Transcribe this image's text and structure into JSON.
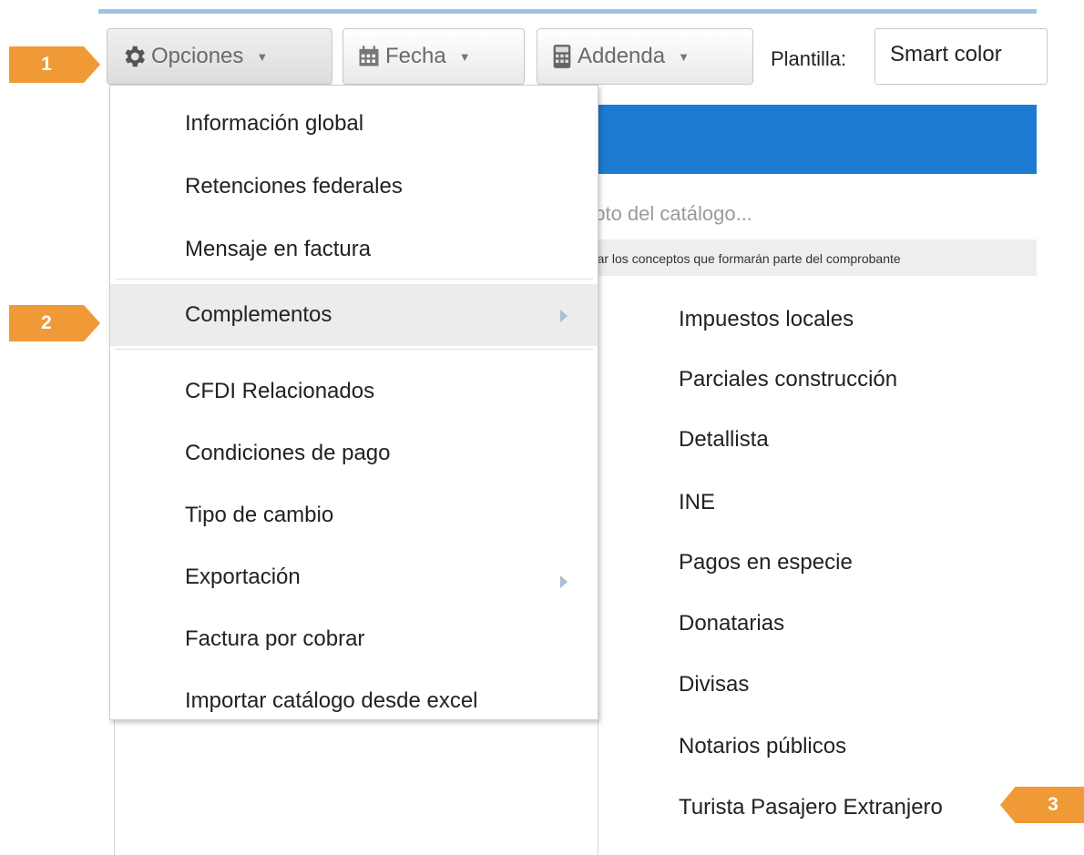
{
  "toolbar": {
    "opciones_label": "Opciones",
    "fecha_label": "Fecha",
    "addenda_label": "Addenda",
    "plantilla_label": "Plantilla:",
    "plantilla_value": "Smart color"
  },
  "background": {
    "search_placeholder": "epto del catálogo...",
    "hint": "onar los conceptos que formarán parte del comprobante"
  },
  "menu": {
    "items": [
      {
        "label": "Información global"
      },
      {
        "label": "Retenciones federales"
      },
      {
        "label": "Mensaje en factura"
      },
      {
        "label": "Complementos"
      },
      {
        "label": "CFDI Relacionados"
      },
      {
        "label": "Condiciones de pago"
      },
      {
        "label": "Tipo de cambio"
      },
      {
        "label": "Exportación"
      },
      {
        "label": "Factura por cobrar"
      },
      {
        "label": "Importar catálogo desde excel"
      }
    ]
  },
  "submenu": {
    "items": [
      {
        "label": "Impuestos locales"
      },
      {
        "label": "Parciales construcción"
      },
      {
        "label": "Detallista"
      },
      {
        "label": "INE"
      },
      {
        "label": "Pagos en especie"
      },
      {
        "label": "Donatarias"
      },
      {
        "label": "Divisas"
      },
      {
        "label": "Notarios públicos"
      },
      {
        "label": "Turista Pasajero Extranjero"
      }
    ]
  },
  "badges": {
    "b1": "1",
    "b2": "2",
    "b3": "3"
  },
  "colors": {
    "accent_blue": "#1c7bd0",
    "badge_orange": "#ef9a36"
  },
  "icons": {
    "opciones": "gear-icon",
    "fecha": "calendar-icon",
    "addenda": "calculator-icon"
  }
}
